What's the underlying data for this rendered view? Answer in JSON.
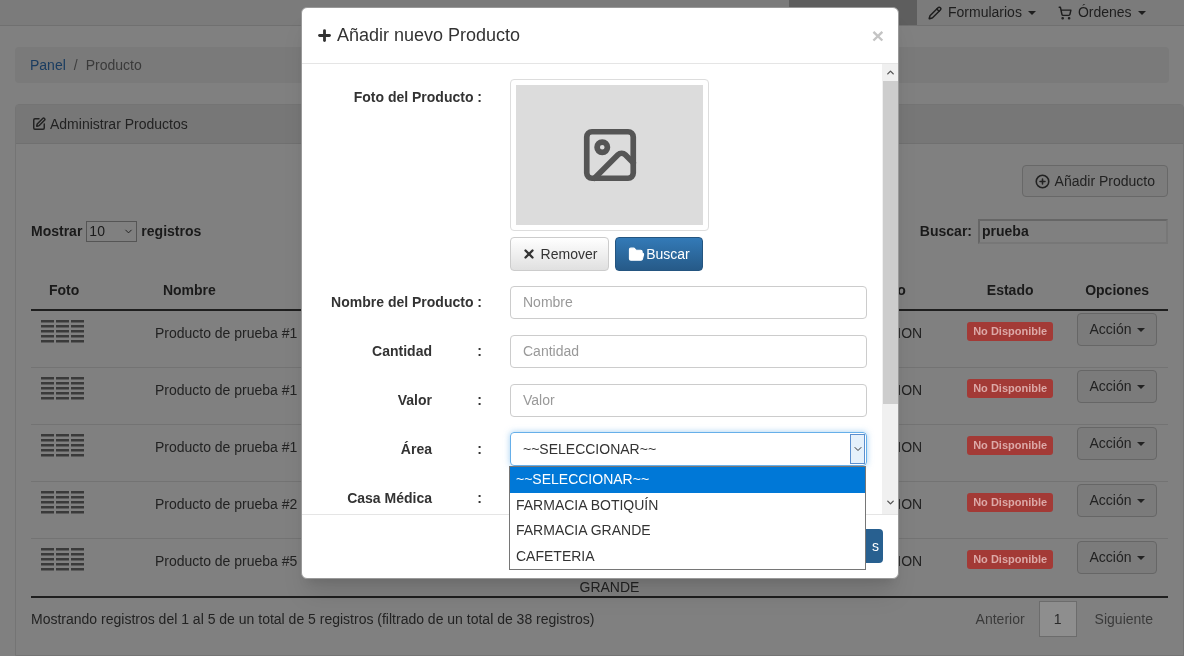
{
  "navbar": {
    "items": [
      {
        "dropdown": false,
        "selected": true
      },
      {
        "label": "Formularios",
        "dropdown": true,
        "selected": false
      },
      {
        "label": "Órdenes",
        "dropdown": true,
        "selected": false
      }
    ]
  },
  "breadcrumb": {
    "items": [
      {
        "label": "Panel",
        "link": true
      },
      {
        "label": "Producto",
        "link": false
      }
    ],
    "separator": "/"
  },
  "panel": {
    "title": "Administrar Productos",
    "add_button": "Añadir Producto",
    "length": {
      "before": "Mostrar",
      "value": "10",
      "after": "registros"
    },
    "search": {
      "label": "Buscar:",
      "value": "prueba"
    },
    "table": {
      "columns": [
        "Foto",
        "Nombre",
        "o",
        "Estado",
        "Opciones"
      ],
      "rows": [
        {
          "name": "Producto de prueba #1",
          "column_3": "ION",
          "status": "No Disponible",
          "action": "Acción"
        },
        {
          "name": "Producto de prueba #1",
          "column_3": "ION",
          "status": "No Disponible",
          "action": "Acción"
        },
        {
          "name": "Producto de prueba #1",
          "column_3": "ION",
          "status": "No Disponible",
          "action": "Acción"
        },
        {
          "name": "Producto de prueba #2",
          "column_3": "ION",
          "status": "No Disponible",
          "action": "Acción"
        },
        {
          "name": "Producto de prueba #5",
          "column_3": "ION",
          "status": "No Disponible",
          "action": "Acción",
          "covered_tail": "GRANDE"
        }
      ]
    },
    "info": "Mostrando registros del 1 al 5 de un total de 5 registros (filtrado de un total de 38 registros)",
    "pagination": {
      "previous": "Anterior",
      "pages": [
        {
          "label": "1",
          "selected": true
        }
      ],
      "next": "Siguiente"
    }
  },
  "modal": {
    "title": "Añadir nuevo Producto",
    "close": "×",
    "photo": {
      "label": "Foto del Producto :",
      "remove": "Remover",
      "browse": "Buscar"
    },
    "fields": [
      {
        "kind": "text",
        "label": "Nombre del Producto :",
        "placeholder": "Nombre"
      },
      {
        "kind": "text",
        "label": "Cantidad",
        "colon": ":",
        "placeholder": "Cantidad"
      },
      {
        "kind": "text",
        "label": "Valor",
        "colon": ":",
        "placeholder": "Valor"
      },
      {
        "kind": "select",
        "label": "Área",
        "colon": ":",
        "value": "~~SELECCIONAR~~",
        "focused": true
      },
      {
        "kind": "covered",
        "label": "Casa Médica",
        "colon": ":"
      }
    ],
    "dropdown": [
      {
        "label": "~~SELECCIONAR~~",
        "selected": true
      },
      {
        "label": "FARMACIA BOTIQUÍN",
        "selected": false
      },
      {
        "label": "FARMACIA GRANDE",
        "selected": false
      },
      {
        "label": "CAFETERIA",
        "selected": false
      }
    ],
    "footer_button": "s"
  }
}
